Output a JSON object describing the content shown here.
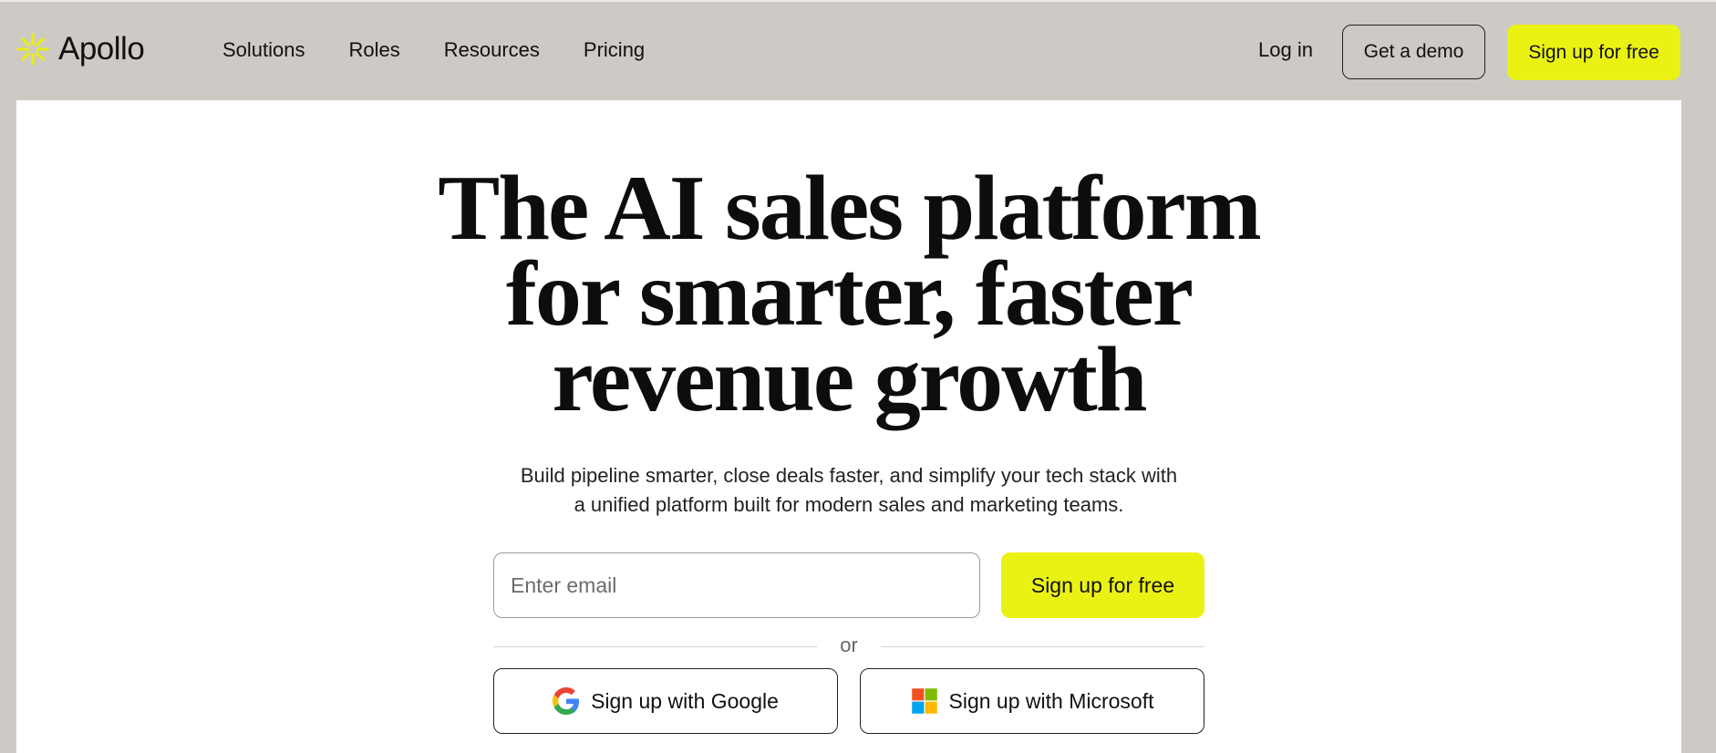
{
  "brand": {
    "name": "Apollo",
    "accent": "#eaf214",
    "logo_color": "#eaf214"
  },
  "nav": {
    "links": [
      "Solutions",
      "Roles",
      "Resources",
      "Pricing"
    ],
    "login": "Log in",
    "demo": "Get a demo",
    "signup": "Sign up for free"
  },
  "hero": {
    "headline": [
      "The AI sales platform",
      "for smarter, faster",
      "revenue growth"
    ],
    "subhead": [
      "Build pipeline smarter, close deals faster, and simplify your tech stack with",
      "a unified platform built for modern sales and marketing teams."
    ],
    "email_placeholder": "Enter email",
    "signup": "Sign up for free",
    "or": "or",
    "google": "Sign up with Google",
    "microsoft": "Sign up with Microsoft"
  },
  "icons": {
    "logo": "apollo-star-icon",
    "google": "google-icon",
    "microsoft": "microsoft-icon"
  }
}
